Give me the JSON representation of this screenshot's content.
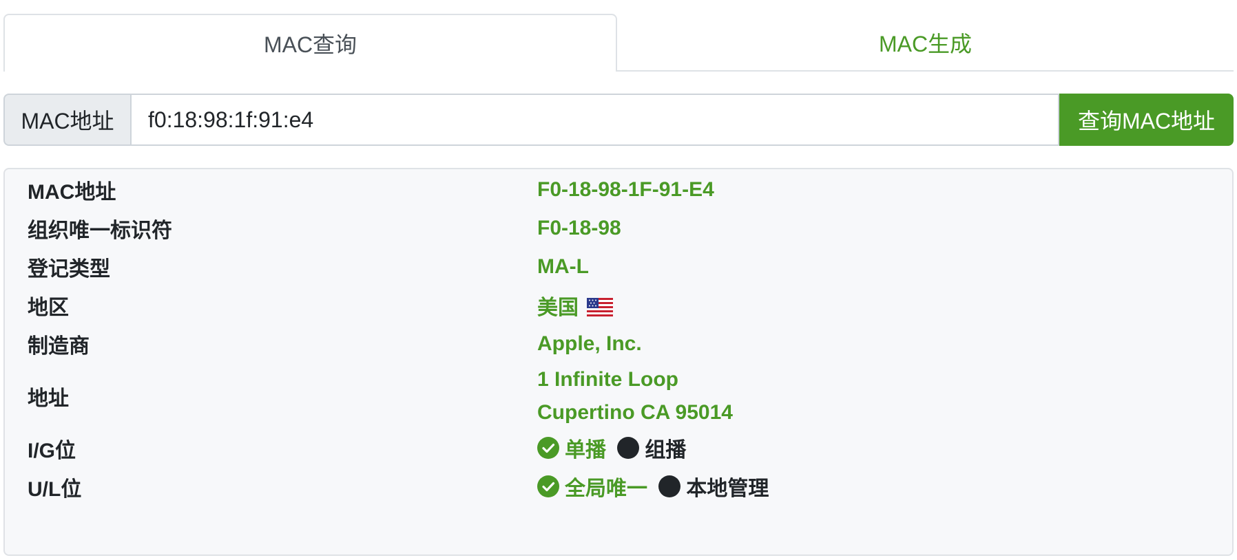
{
  "tabs": [
    {
      "label": "MAC查询",
      "active": true
    },
    {
      "label": "MAC生成",
      "active": false
    }
  ],
  "search": {
    "label": "MAC地址",
    "value": "f0:18:98:1f:91:e4",
    "button_label": "查询MAC地址"
  },
  "result": {
    "rows": [
      {
        "key": "MAC地址",
        "value": "F0-18-98-1F-91-E4"
      },
      {
        "key": "组织唯一标识符",
        "value": "F0-18-98"
      },
      {
        "key": "登记类型",
        "value": "MA-L"
      },
      {
        "key": "地区",
        "value": "美国",
        "flag": "us-flag-icon"
      },
      {
        "key": "制造商",
        "value": "Apple, Inc."
      },
      {
        "key": "地址",
        "lines": [
          "1 Infinite Loop",
          "Cupertino CA 95014"
        ]
      },
      {
        "key": "I/G位",
        "selected": "单播",
        "other": "组播"
      },
      {
        "key": "U/L位",
        "selected": "全局唯一",
        "other": "本地管理"
      }
    ]
  },
  "colors": {
    "accent": "#4a9a26",
    "text": "#212529",
    "card_bg": "#f7f8fa",
    "border": "#dee2e6"
  }
}
